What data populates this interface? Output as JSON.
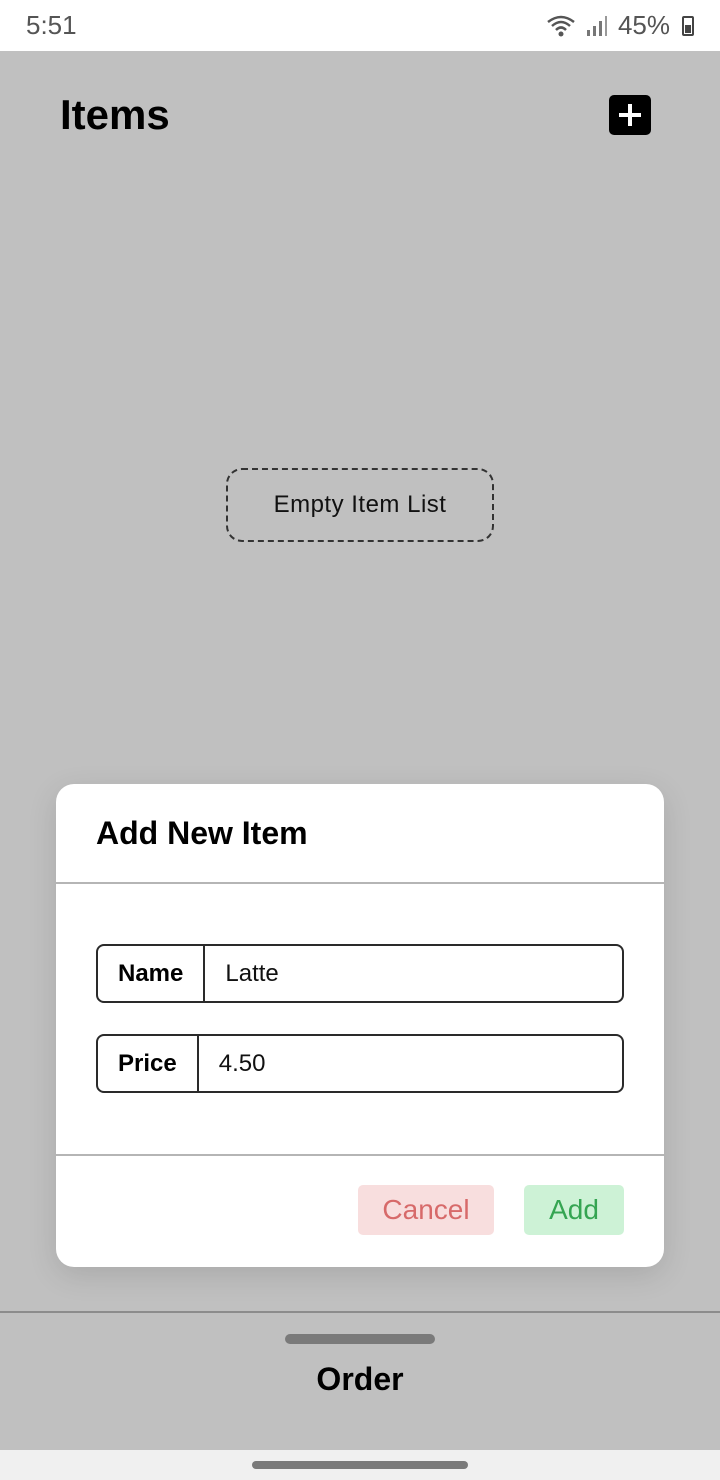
{
  "status_bar": {
    "time": "5:51",
    "battery": "45%"
  },
  "header": {
    "title": "Items",
    "add_icon": "plus-icon"
  },
  "list": {
    "empty_text": "Empty Item List"
  },
  "dialog": {
    "title": "Add New Item",
    "fields": [
      {
        "label": "Name",
        "value": "Latte"
      },
      {
        "label": "Price",
        "value": "4.50"
      }
    ],
    "cancel_label": "Cancel",
    "add_label": "Add",
    "colors": {
      "cancel_bg": "#f8dede",
      "cancel_text": "#d76a6a",
      "add_bg": "#cdf2d6",
      "add_text": "#35a552"
    }
  },
  "bottom_sheet": {
    "label": "Order"
  }
}
